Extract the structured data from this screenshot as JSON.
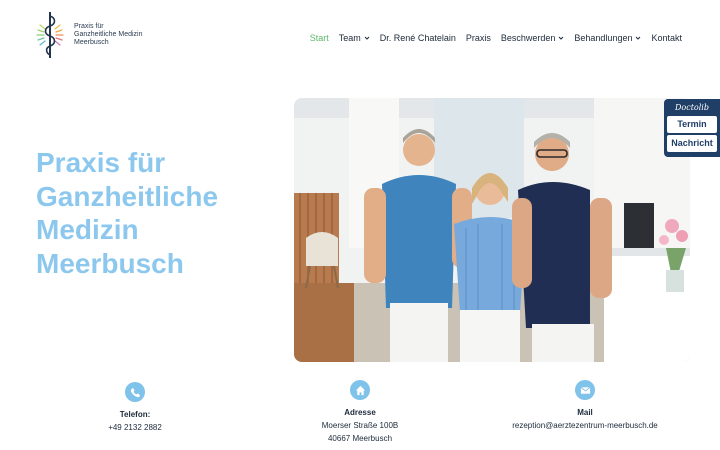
{
  "logo": {
    "line1": "Praxis für",
    "line2": "Ganzheitliche Medizin",
    "line3": "Meerbusch",
    "icon": "caduceus-icon"
  },
  "nav": {
    "items": [
      {
        "label": "Start",
        "active": true,
        "dropdown": false
      },
      {
        "label": "Team",
        "active": false,
        "dropdown": true
      },
      {
        "label": "Dr. René Chatelain",
        "active": false,
        "dropdown": false
      },
      {
        "label": "Praxis",
        "active": false,
        "dropdown": false
      },
      {
        "label": "Beschwerden",
        "active": false,
        "dropdown": true
      },
      {
        "label": "Behandlungen",
        "active": false,
        "dropdown": true
      },
      {
        "label": "Kontakt",
        "active": false,
        "dropdown": false
      }
    ]
  },
  "hero": {
    "title_lines": [
      "Praxis für",
      "Ganzheitliche",
      "Medizin",
      "Meerbusch"
    ],
    "photo_icon": "team-photo"
  },
  "doctolib": {
    "brand": "Doctolib",
    "termin": "Termin",
    "nachricht": "Nachricht"
  },
  "contact": {
    "phone": {
      "label": "Telefon:",
      "value": "+49 2132 2882",
      "icon": "phone-icon"
    },
    "address": {
      "label": "Adresse",
      "line1": "Moerser Straße 100B",
      "line2": "40667 Meerbusch",
      "icon": "home-icon"
    },
    "mail": {
      "label": "Mail",
      "value": "rezeption@aerztezentrum-meerbusch.de",
      "icon": "mail-icon"
    }
  },
  "colors": {
    "accent_blue": "#8cc8ee",
    "active_green": "#5cb86b",
    "doctolib_navy": "#1f3f66"
  }
}
